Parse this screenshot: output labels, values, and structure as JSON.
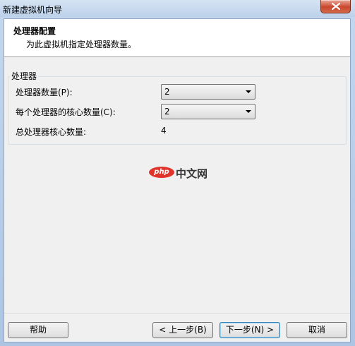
{
  "window": {
    "title": "新建虚拟机向导"
  },
  "header": {
    "title": "处理器配置",
    "subtitle": "为此虚拟机指定处理器数量。"
  },
  "processor_group": {
    "legend": "处理器",
    "processor_count": {
      "label": "处理器数量(P):",
      "value": "2"
    },
    "cores_per_processor": {
      "label": "每个处理器的核心数量(C):",
      "value": "2"
    },
    "total_cores": {
      "label": "总处理器核心数量:",
      "value": "4"
    }
  },
  "watermark": {
    "logo_text": "php",
    "site_text": "中文网"
  },
  "footer": {
    "help_label": "帮助",
    "back_label": "< 上一步(B)",
    "next_label": "下一步(N) >",
    "cancel_label": "取消"
  },
  "colors": {
    "watermark_red": "#e0332b",
    "close_button": "#c9462c"
  }
}
